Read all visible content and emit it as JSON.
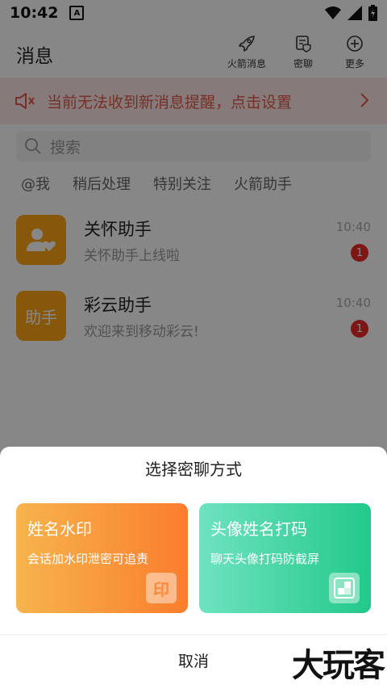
{
  "status": {
    "time": "10:42",
    "a_badge": "A"
  },
  "header": {
    "title": "消息"
  },
  "top_actions": [
    {
      "label": "火箭消息",
      "icon": "rocket-icon"
    },
    {
      "label": "密聊",
      "icon": "secret-chat-icon"
    },
    {
      "label": "更多",
      "icon": "plus-circle-icon"
    }
  ],
  "notice": {
    "text": "当前无法收到新消息提醒，点击设置"
  },
  "search": {
    "placeholder": "搜索"
  },
  "filters": [
    "@我",
    "稍后处理",
    "特别关注",
    "火箭助手"
  ],
  "chats": [
    {
      "name": "关怀助手",
      "preview": "关怀助手上线啦",
      "time": "10:40",
      "badge": "1",
      "avatar_text": ""
    },
    {
      "name": "彩云助手",
      "preview": "欢迎来到移动彩云!",
      "time": "10:40",
      "badge": "1",
      "avatar_text": "助手"
    }
  ],
  "sheet": {
    "title": "选择密聊方式",
    "options": [
      {
        "title": "姓名水印",
        "desc": "会话加水印泄密可追责",
        "icon_text": "印"
      },
      {
        "title": "头像姓名打码",
        "desc": "聊天头像打码防截屏",
        "icon_text": ""
      }
    ],
    "cancel": "取消"
  },
  "watermark": "大玩客",
  "colors": {
    "accent_orange": "#ffa617",
    "notice_red": "#e05a4a",
    "badge_red": "#ee2a2a",
    "option_orange": "#fb7d2d",
    "option_green": "#22c98a"
  }
}
